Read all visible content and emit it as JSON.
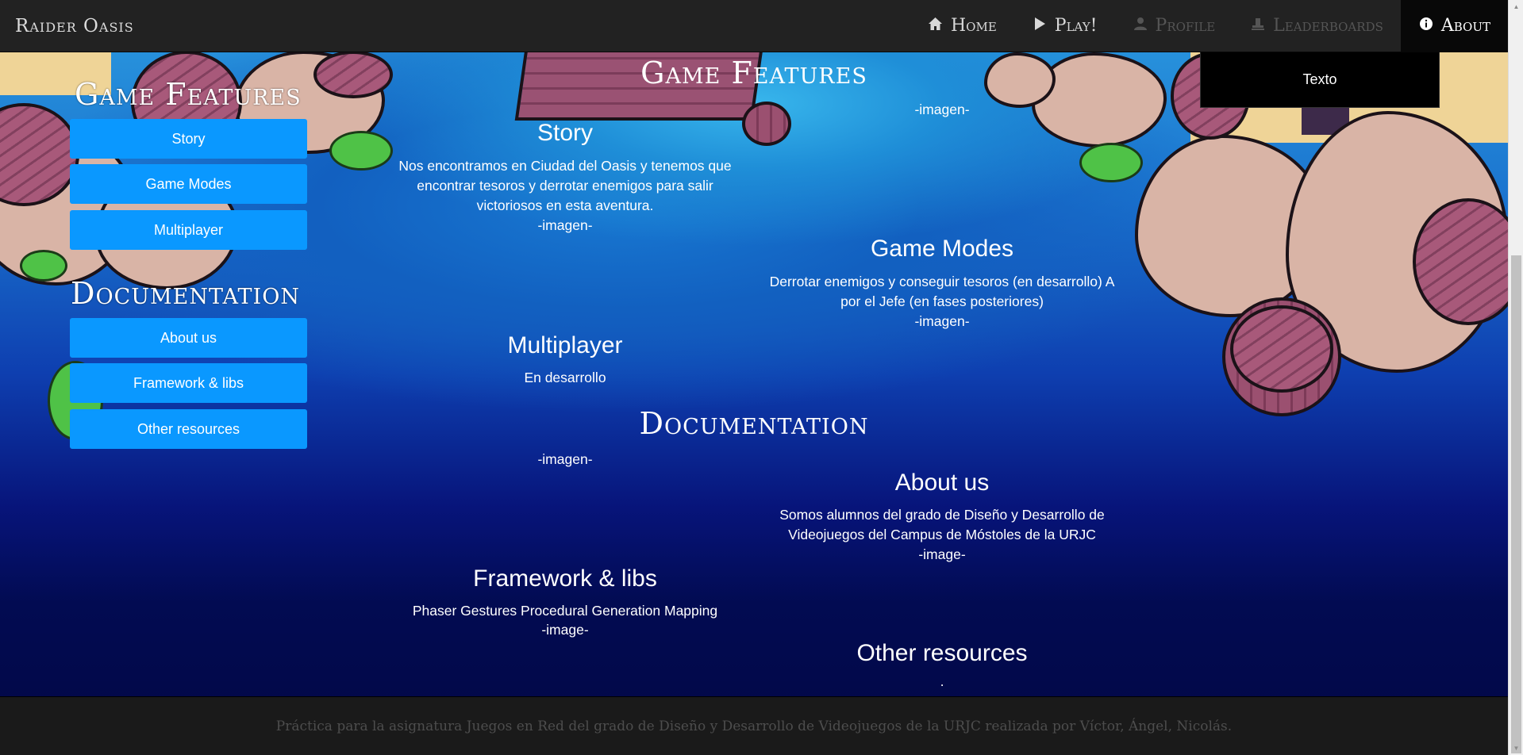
{
  "navbar": {
    "brand": "Raider Oasis",
    "items": [
      {
        "label": "Home",
        "icon": "home-icon"
      },
      {
        "label": "Play!",
        "icon": "play-icon"
      },
      {
        "label": "Profile",
        "icon": "user-icon"
      },
      {
        "label": "Leaderboards",
        "icon": "podium-icon"
      },
      {
        "label": "About",
        "icon": "info-icon"
      }
    ],
    "dropdown_text": "Texto"
  },
  "sidebar": {
    "game_features_title": "Game Features",
    "game_features_buttons": [
      "Story",
      "Game Modes",
      "Multiplayer"
    ],
    "documentation_title": "Documentation",
    "documentation_buttons": [
      "About us",
      "Framework & libs",
      "Other resources"
    ]
  },
  "content": {
    "game_features_title": "Game Features",
    "top_image": "-imagen-",
    "story": {
      "title": "Story",
      "text": "Nos encontramos en Ciudad del Oasis y tenemos que encontrar tesoros y derrotar enemigos para salir victoriosos en esta aventura.",
      "image": "-imagen-"
    },
    "game_modes": {
      "title": "Game Modes",
      "text": "Derrotar enemigos y conseguir tesoros (en desarrollo) A por el Jefe (en fases posteriores)",
      "image": "-imagen-"
    },
    "multiplayer": {
      "title": "Multiplayer",
      "text": "En desarrollo"
    },
    "documentation_title": "Documentation",
    "doc_image": "-imagen-",
    "about_us": {
      "title": "About us",
      "text": "Somos alumnos del grado de Diseño y Desarrollo de Videojuegos del Campus de Móstoles de la URJC",
      "image": "-image-"
    },
    "framework": {
      "title": "Framework & libs",
      "text": "Phaser Gestures Procedural Generation Mapping",
      "image": "-image-"
    },
    "other_resources": {
      "title": "Other resources",
      "text": "."
    }
  },
  "footer": {
    "text": "Práctica para la asignatura Juegos en Red del grado de Diseño y Desarrollo de Videojuegos de la URJC realizada por Víctor, Ángel, Nicolás."
  }
}
